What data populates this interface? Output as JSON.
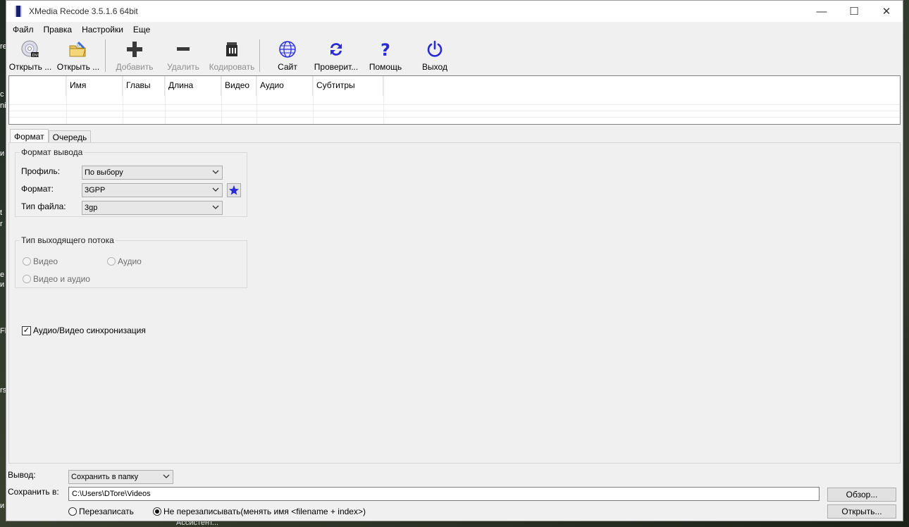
{
  "window": {
    "title": "XMedia Recode 3.5.1.6 64bit",
    "controls": {
      "minimize": "—",
      "maximize": "☐",
      "close": "✕"
    }
  },
  "menu": [
    "Файл",
    "Правка",
    "Настройки",
    "Еще"
  ],
  "toolbar": [
    {
      "label": "Открыть ...",
      "icon": "dvd-disc-icon",
      "disabled": false
    },
    {
      "label": "Открыть ...",
      "icon": "open-folder-icon",
      "disabled": false
    },
    {
      "label": "Добавить",
      "icon": "plus-icon",
      "disabled": true
    },
    {
      "label": "Удалить",
      "icon": "minus-icon",
      "disabled": true
    },
    {
      "label": "Кодировать",
      "icon": "encode-icon",
      "disabled": true
    },
    {
      "label": "Сайт",
      "icon": "globe-icon",
      "disabled": false
    },
    {
      "label": "Проверит...",
      "icon": "refresh-icon",
      "disabled": false
    },
    {
      "label": "Помощь",
      "icon": "help-icon",
      "disabled": false
    },
    {
      "label": "Выход",
      "icon": "power-icon",
      "disabled": false
    }
  ],
  "file_list": {
    "columns": [
      "",
      "Имя",
      "Главы",
      "Длина",
      "Видео",
      "Аудио",
      "Субтитры"
    ],
    "rows": []
  },
  "tabs": [
    "Формат",
    "Очередь"
  ],
  "output_format": {
    "title": "Формат вывода",
    "profile_label": "Профиль:",
    "profile_value": "По выбору",
    "format_label": "Формат:",
    "format_value": "3GPP",
    "filetype_label": "Тип файла:",
    "filetype_value": "3gp"
  },
  "stream_type": {
    "title": "Тип выходящего потока",
    "video": "Видео",
    "audio": "Аудио",
    "video_audio": "Видео и аудио"
  },
  "sync": {
    "label": "Аудио/Видео синхронизация",
    "checked": true
  },
  "output": {
    "label": "Вывод:",
    "mode": "Сохранить в папку",
    "save_label": "Сохранить в:",
    "path": "C:\\Users\\DTore\\Videos",
    "browse": "Обзор...",
    "open": "Открыть...",
    "overwrite": "Перезаписать",
    "no_overwrite": "Не перезаписывать(менять имя <filename + index>)"
  },
  "desktop": {
    "bottom_text": "Ассистент..."
  },
  "colors": {
    "accent": "#2b2bd6",
    "disabled": "#8f8f8f"
  }
}
